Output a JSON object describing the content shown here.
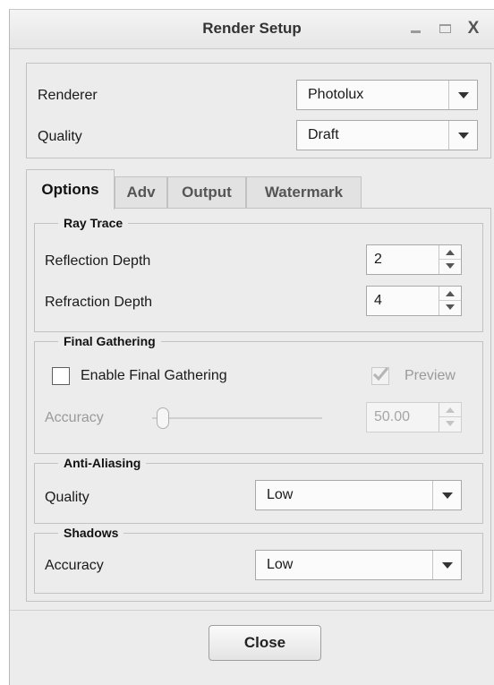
{
  "window": {
    "title": "Render Setup",
    "controls": [
      "minimize-icon",
      "maximize-icon",
      "close-icon"
    ],
    "close_glyph": "X"
  },
  "renderer_group": {
    "renderer_label": "Renderer",
    "renderer_value": "Photolux",
    "quality_label": "Quality",
    "quality_value": "Draft"
  },
  "tabs": [
    {
      "label": "Options",
      "active": true
    },
    {
      "label": "Adv",
      "active": false
    },
    {
      "label": "Output",
      "active": false
    },
    {
      "label": "Watermark",
      "active": false
    }
  ],
  "options": {
    "ray_trace": {
      "legend": "Ray Trace",
      "reflection_label": "Reflection Depth",
      "reflection_value": "2",
      "refraction_label": "Refraction Depth",
      "refraction_value": "4"
    },
    "final_gathering": {
      "legend": "Final Gathering",
      "enable_label": "Enable Final Gathering",
      "enable_checked": false,
      "preview_label": "Preview",
      "preview_checked": true,
      "accuracy_label": "Accuracy",
      "accuracy_value": "50.00",
      "accuracy_slider_fraction": 0.0
    },
    "anti_aliasing": {
      "legend": "Anti-Aliasing",
      "quality_label": "Quality",
      "quality_value": "Low"
    },
    "shadows": {
      "legend": "Shadows",
      "accuracy_label": "Accuracy",
      "accuracy_value": "Low"
    }
  },
  "footer": {
    "close_label": "Close"
  },
  "colors": {
    "background": "#ececec",
    "disabled_text": "#9a9a9a",
    "border": "#c2c2c2"
  }
}
